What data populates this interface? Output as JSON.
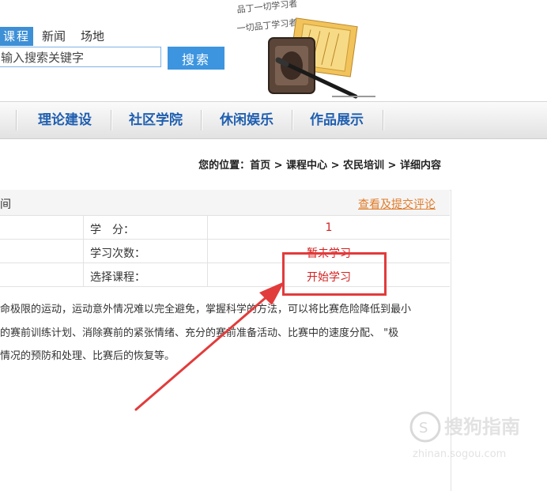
{
  "search": {
    "tabs": [
      {
        "label": "课程",
        "active": true
      },
      {
        "label": "新闻",
        "active": false
      },
      {
        "label": "场地",
        "active": false
      }
    ],
    "placeholder": "输入搜索关键字",
    "button_label": "搜索"
  },
  "logo": {
    "calligraphy_line1": "品丁一切学习者",
    "calligraphy_line2": "一切品丁学习者"
  },
  "nav": {
    "items": [
      "理论建设",
      "社区学院",
      "休闲娱乐",
      "作品展示"
    ]
  },
  "breadcrumb": {
    "prefix": "您的位置：",
    "path": [
      "首页",
      "课程中心",
      "农民培训",
      "详细内容"
    ],
    "separator": " > "
  },
  "course": {
    "title_fragment": "间",
    "review_link": "查看及提交评论",
    "rows": [
      {
        "label": "学　分：",
        "value": "1"
      },
      {
        "label": "学习次数：",
        "value": "暂未学习"
      },
      {
        "label": "选择课程：",
        "value": "开始学习"
      }
    ],
    "description_lines": [
      "命极限的运动，运动意外情况难以完全避免，掌握科学的方法，可以将比赛危险降低到最小",
      "的赛前训练计划、消除赛前的紧张情绪、充分的赛前准备活动、比赛中的速度分配、 \"极",
      "情况的预防和处理、比赛后的恢复等。"
    ]
  },
  "watermark": {
    "text": "搜狗指南",
    "url": "zhinan.sogou.com"
  },
  "colors": {
    "accent_blue": "#3d8fd6",
    "nav_text": "#1f5fb0",
    "value_red": "#d42020",
    "link_orange": "#e07b2a",
    "annotation_red": "#e23b3b"
  }
}
